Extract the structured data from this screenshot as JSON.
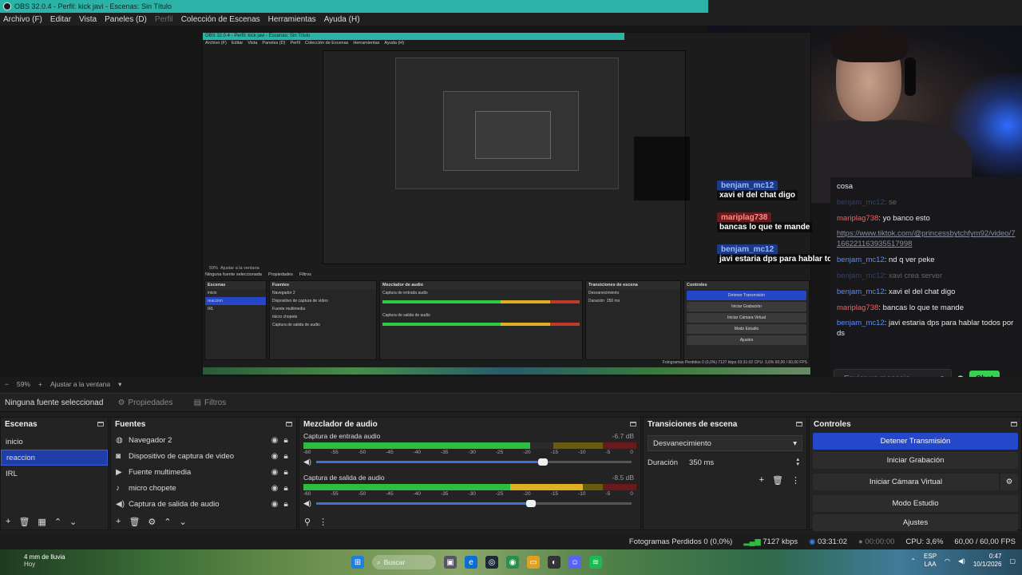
{
  "window": {
    "title": "OBS 32.0.4 - Perfil: kick javi - Escenas: Sin Título"
  },
  "menu": [
    "Archivo (F)",
    "Editar",
    "Vista",
    "Paneles (D)",
    "Perfil",
    "Colección de Escenas",
    "Herramientas",
    "Ayuda (H)"
  ],
  "nested": {
    "title": "OBS 32.0.4 - Perfil: kick javi - Escenas: Sin Título",
    "menu": [
      "Archivo (F)",
      "Editar",
      "Vista",
      "Paneles (D)",
      "Perfil",
      "Colección de Escenas",
      "Herramientas",
      "Ayuda (H)"
    ],
    "zoom_label": "59%",
    "fit_label": "Ajustar a la ventana",
    "no_source": "Ninguna fuente seleccionada",
    "props": "Propiedades",
    "filters": "Filtros",
    "scenes_title": "Escenas",
    "scenes": [
      "inicio",
      "reaccion",
      "IRL"
    ],
    "sources_title": "Fuentes",
    "sources": [
      "Navegador 2",
      "Dispositivo de captura de vídeo",
      "Fuente multimedia",
      "micro chopete",
      "Captura de salida de audio"
    ],
    "mixer_title": "Mezclador de audio",
    "mixer_ch1": "Captura de entrada audio",
    "mixer_ch2": "Captura de salida de audio",
    "trans_title": "Transiciones de escena",
    "trans_select": "Desvanecimiento",
    "trans_duration_label": "Duración",
    "trans_duration": "350 ms",
    "controls_title": "Controles",
    "controls": [
      "Detener Transmisión",
      "Iniciar Grabación",
      "Iniciar Cámara Virtual",
      "Modo Estudio",
      "Ajustes"
    ],
    "status": "Fotogramas Perdidos 0 (0,0%)   7127 kbps   03:31:02   CPU: 3,6%   60,00 / 60,00 FPS"
  },
  "chat_overlay": [
    {
      "user": "benjam_mc12",
      "color": "blue",
      "msg": "xavi el del chat digo"
    },
    {
      "user": "mariplag738",
      "color": "red",
      "msg": "bancas lo que te mande"
    },
    {
      "user": "benjam_mc12",
      "color": "blue",
      "msg": "javi estaria dps para hablar todos por ds"
    }
  ],
  "chat": {
    "lines": [
      {
        "user": "",
        "text": "cosa",
        "dim": false
      },
      {
        "user": "benjam_mc12",
        "color": "blue",
        "text": "se",
        "dim": true
      },
      {
        "user": "mariplag738",
        "color": "red",
        "text": "yo banco esto",
        "dim": false
      },
      {
        "user": "",
        "link": "https://www.tiktok.com/@princessbytchfym92/video/7166221163935517998",
        "dim": false
      },
      {
        "user": "benjam_mc12",
        "color": "blue",
        "text": "nd q ver peke",
        "dim": false
      },
      {
        "user": "benjam_mc12",
        "color": "blue",
        "text": "xavi crea server",
        "dim": true
      },
      {
        "user": "benjam_mc12",
        "color": "blue",
        "text": "xavi el del chat digo",
        "dim": false
      },
      {
        "user": "mariplag738",
        "color": "red",
        "text": "bancas lo que te mande",
        "dim": false
      },
      {
        "user": "benjam_mc12",
        "color": "blue",
        "text": "javi estaria dps para hablar todos por ds",
        "dim": false
      }
    ],
    "input_placeholder": "Enviar un mensaje",
    "send_label": "Chat"
  },
  "zoom": {
    "minus": "−",
    "value": "59%",
    "plus": "+",
    "fit": "Ajustar a la ventana"
  },
  "selection": {
    "none": "Ninguna fuente seleccionad",
    "properties": "Propiedades",
    "filters": "Filtros"
  },
  "scenes": {
    "title": "Escenas",
    "items": [
      "inicio",
      "reaccion",
      "IRL"
    ],
    "selected_index": 1
  },
  "sources": {
    "title": "Fuentes",
    "items": [
      {
        "label": "Navegador 2",
        "icon": "globe-icon"
      },
      {
        "label": "Dispositivo de captura de video",
        "icon": "camera-icon"
      },
      {
        "label": "Fuente multimedia",
        "icon": "play-icon"
      },
      {
        "label": "micro chopete",
        "icon": "microphone-icon"
      },
      {
        "label": "Captura de salida de audio",
        "icon": "speaker-icon"
      }
    ]
  },
  "mixer": {
    "title": "Mezclador de audio",
    "channels": [
      {
        "name": "Captura de entrada audio",
        "db": "-6.7 dB",
        "level": 0.68,
        "peak": 0.68,
        "fader": 0.72
      },
      {
        "name": "Captura de salida de audio",
        "db": "-8.5 dB",
        "level": 0.62,
        "peak": 0.84,
        "fader": 0.68
      }
    ],
    "ticks": [
      "-60",
      "-55",
      "-50",
      "-45",
      "-40",
      "-35",
      "-30",
      "-25",
      "-20",
      "-15",
      "-10",
      "-5",
      "0"
    ]
  },
  "transitions": {
    "title": "Transiciones de escena",
    "selected": "Desvanecimiento",
    "duration_label": "Duración",
    "duration_value": "350 ms"
  },
  "controls": {
    "title": "Controles",
    "buttons": [
      "Detener Transmisión",
      "Iniciar Grabación",
      "Iniciar Cámara Virtual",
      "Modo Estudio",
      "Ajustes"
    ]
  },
  "status": {
    "dropped": "Fotogramas Perdidos 0 (0,0%)",
    "bitrate": "7127 kbps",
    "stream_time": "03:31:02",
    "rec_time": "00:00:00",
    "cpu": "CPU: 3,6%",
    "fps": "60,00 / 60,00 FPS"
  },
  "taskbar": {
    "weather": "4 mm de lluvia",
    "weather_sub": "Hoy",
    "search": "Buscar",
    "lang_top": "ESP",
    "lang_bottom": "LAA",
    "time": "0:47",
    "date": "10/1/2026"
  },
  "colors": {
    "accent": "#2448c9",
    "titlebar": "#2bb3a7",
    "chat_send": "#38d14f",
    "user_blue": "#5a8cff",
    "user_red": "#ff5a5a"
  }
}
